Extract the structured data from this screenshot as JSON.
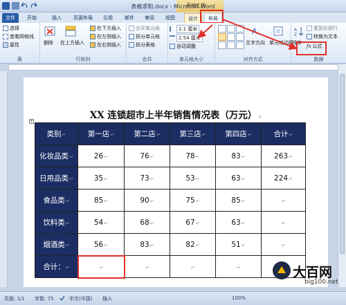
{
  "window": {
    "title": "表格求和.docx - Microsoft Word",
    "context_group": "表格工具"
  },
  "tabs": [
    {
      "label": "文件"
    },
    {
      "label": "开始"
    },
    {
      "label": "插入"
    },
    {
      "label": "页面布局"
    },
    {
      "label": "引用"
    },
    {
      "label": "邮件"
    },
    {
      "label": "审阅"
    },
    {
      "label": "视图"
    },
    {
      "label": "设计"
    },
    {
      "label": "布局"
    }
  ],
  "ribbon": {
    "table_group": {
      "label": "表",
      "select": "选择",
      "gridlines": "查看网格线",
      "properties": "属性"
    },
    "rowscols_group": {
      "label": "行和列",
      "delete": "删除",
      "insert_above": "在上方插入",
      "insert_below": "在下方插入",
      "insert_left": "在左侧插入",
      "insert_right": "在右侧插入"
    },
    "merge_group": {
      "label": "合并",
      "merge_cells": "合并单元格",
      "split_cells": "拆分单元格",
      "split_table": "拆分表格"
    },
    "cellsize_group": {
      "label": "单元格大小",
      "height": "1.1 厘米",
      "width": "2.54 厘米",
      "autofit": "自动调整"
    },
    "align_group": {
      "label": "对齐方式",
      "text_direction": "文字方向",
      "cell_margins": "单元格边距"
    },
    "data_group": {
      "label": "数据",
      "sort": "排序",
      "repeat_header": "重复标题行",
      "convert_text": "转换为文本",
      "formula": "公式"
    }
  },
  "document": {
    "title": "XX 连锁超市上半年销售情况表（万元）",
    "table": {
      "header": [
        "类别",
        "第一店",
        "第二店",
        "第三店",
        "第四店",
        "合计"
      ],
      "rows": [
        {
          "category": "化妆品类",
          "values": [
            "26",
            "76",
            "78",
            "83",
            "263"
          ]
        },
        {
          "category": "日用品类",
          "values": [
            "35",
            "73",
            "53",
            "63",
            "224"
          ]
        },
        {
          "category": "食品类",
          "values": [
            "85",
            "90",
            "75",
            "85",
            ""
          ]
        },
        {
          "category": "饮料类",
          "values": [
            "54",
            "68",
            "67",
            "63",
            ""
          ]
        },
        {
          "category": "烟酒类",
          "values": [
            "56",
            "83",
            "82",
            "51",
            ""
          ]
        },
        {
          "category": "合计：",
          "values": [
            "",
            "",
            "",
            "",
            ""
          ]
        }
      ]
    }
  },
  "statusbar": {
    "page": "页面: 1/1",
    "words": "字数: 75",
    "language": "中文(中国)",
    "mode": "插入",
    "zoom": "100%"
  },
  "watermark": {
    "brand": "大百网",
    "url": "big100.net"
  },
  "colors": {
    "header_bg": "#1b2d63",
    "file_tab": "#2a5ba8",
    "callout": "#e0302a"
  }
}
